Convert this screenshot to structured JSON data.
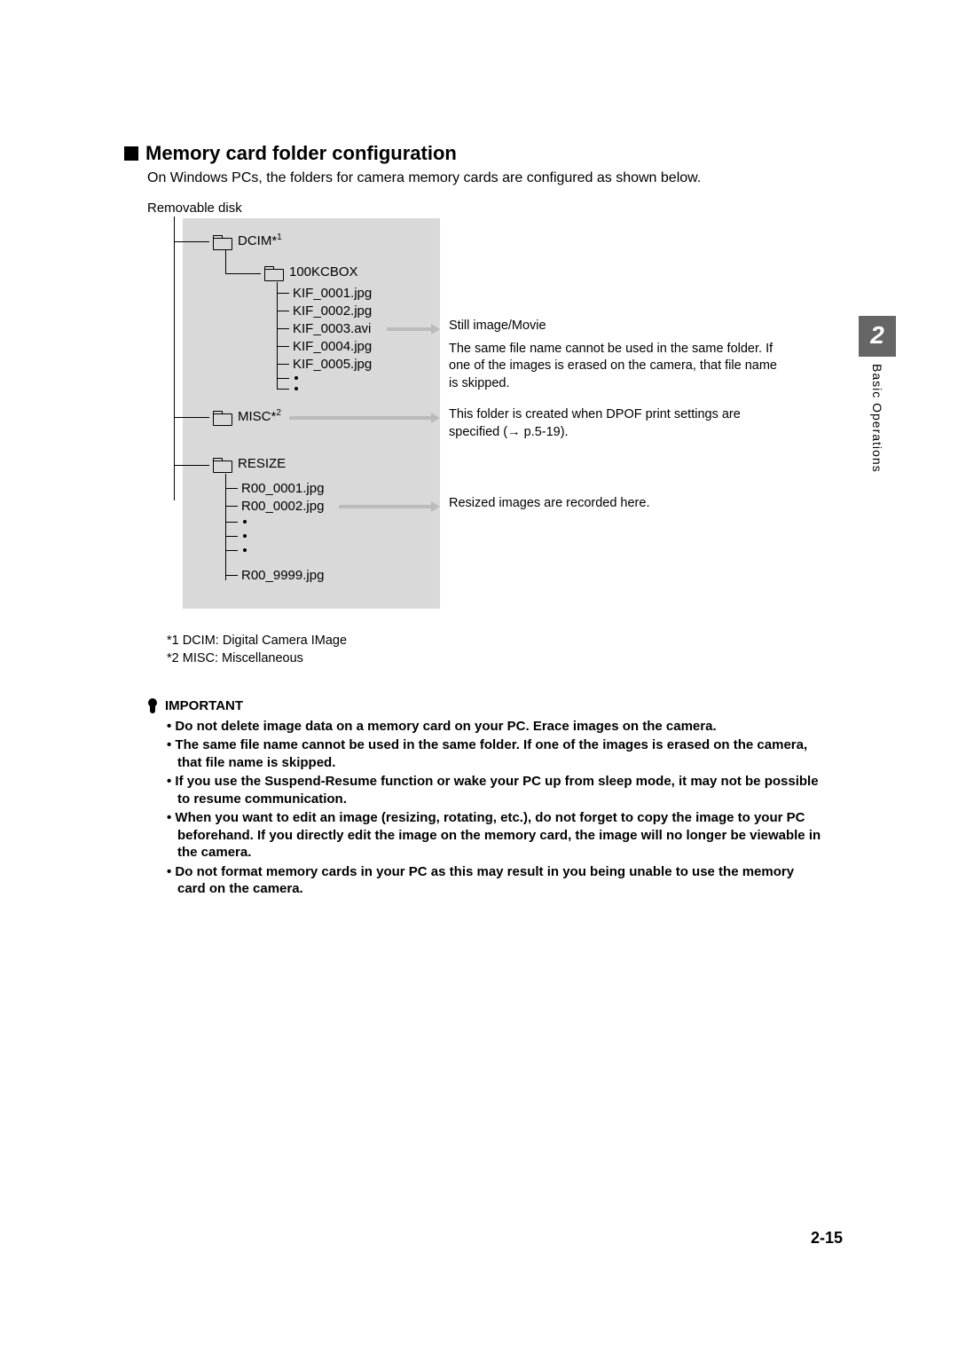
{
  "sideTab": {
    "number": "2",
    "label": "Basic Operations"
  },
  "pageNumber": "2-15",
  "section": {
    "title": "Memory card folder configuration",
    "intro": "On Windows PCs, the folders for camera memory cards are configured as shown below."
  },
  "tree": {
    "root": "Removable disk",
    "dcim": "DCIM*",
    "dcimSup": "1",
    "dcimSub": "100KCBOX",
    "kif": [
      "KIF_0001.jpg",
      "KIF_0002.jpg",
      "KIF_0003.avi",
      "KIF_0004.jpg",
      "KIF_0005.jpg"
    ],
    "misc": "MISC*",
    "miscSup": "2",
    "resize": "RESIZE",
    "resizeFiles": [
      "R00_0001.jpg",
      "R00_0002.jpg"
    ],
    "resizeLast": "R00_9999.jpg"
  },
  "notes": {
    "stillTitle": "Still image/Movie",
    "stillBody": "The same file name cannot be used in the same folder. If one of the images is erased on the camera, that file name is skipped.",
    "miscBody": "This folder is created when DPOF print settings are specified (→ p.5-19).",
    "resizeBody": "Resized images are recorded here."
  },
  "footnotes": {
    "f1": "*1 DCIM: Digital Camera IMage",
    "f2": "*2 MISC: Miscellaneous"
  },
  "important": {
    "heading": "IMPORTANT",
    "items": [
      "Do not delete image data on a memory card on your PC. Erace images on the camera.",
      "The same file name cannot be used in the same folder. If one of the images is erased on the camera, that file name is skipped.",
      "If you use the Suspend-Resume function or wake your PC up from sleep mode, it may not be possible to resume communication.",
      "When you want to edit an image (resizing, rotating, etc.), do not forget to copy the image to your PC beforehand. If you directly edit the image on the memory card, the image will no longer be viewable in the camera.",
      "Do not format memory cards in your PC as this may result in you being unable to use the memory card on the camera."
    ]
  }
}
